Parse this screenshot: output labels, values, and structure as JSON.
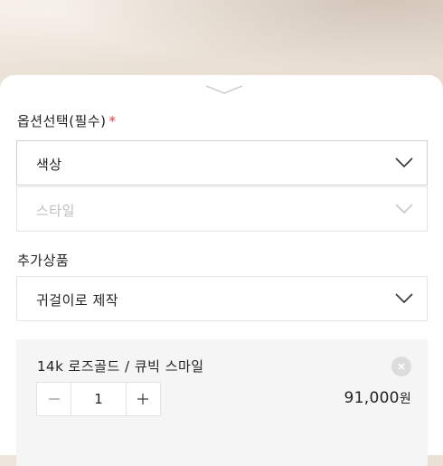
{
  "options": {
    "required_label": "옵션선택(필수)",
    "required_mark": "*",
    "color_select": "색상",
    "style_select": "스타일"
  },
  "addon": {
    "label": "추가상품",
    "select": "귀걸이로 제작"
  },
  "selected_item": {
    "name": "14k 로즈골드 / 큐빅 스마일",
    "quantity": "1",
    "price": "91,000",
    "currency": "원"
  },
  "colors": {
    "required": "#e2413b"
  },
  "icons": [
    "handle-chevron-icon",
    "chevron-down-icon",
    "close-icon",
    "minus-icon",
    "plus-icon"
  ]
}
